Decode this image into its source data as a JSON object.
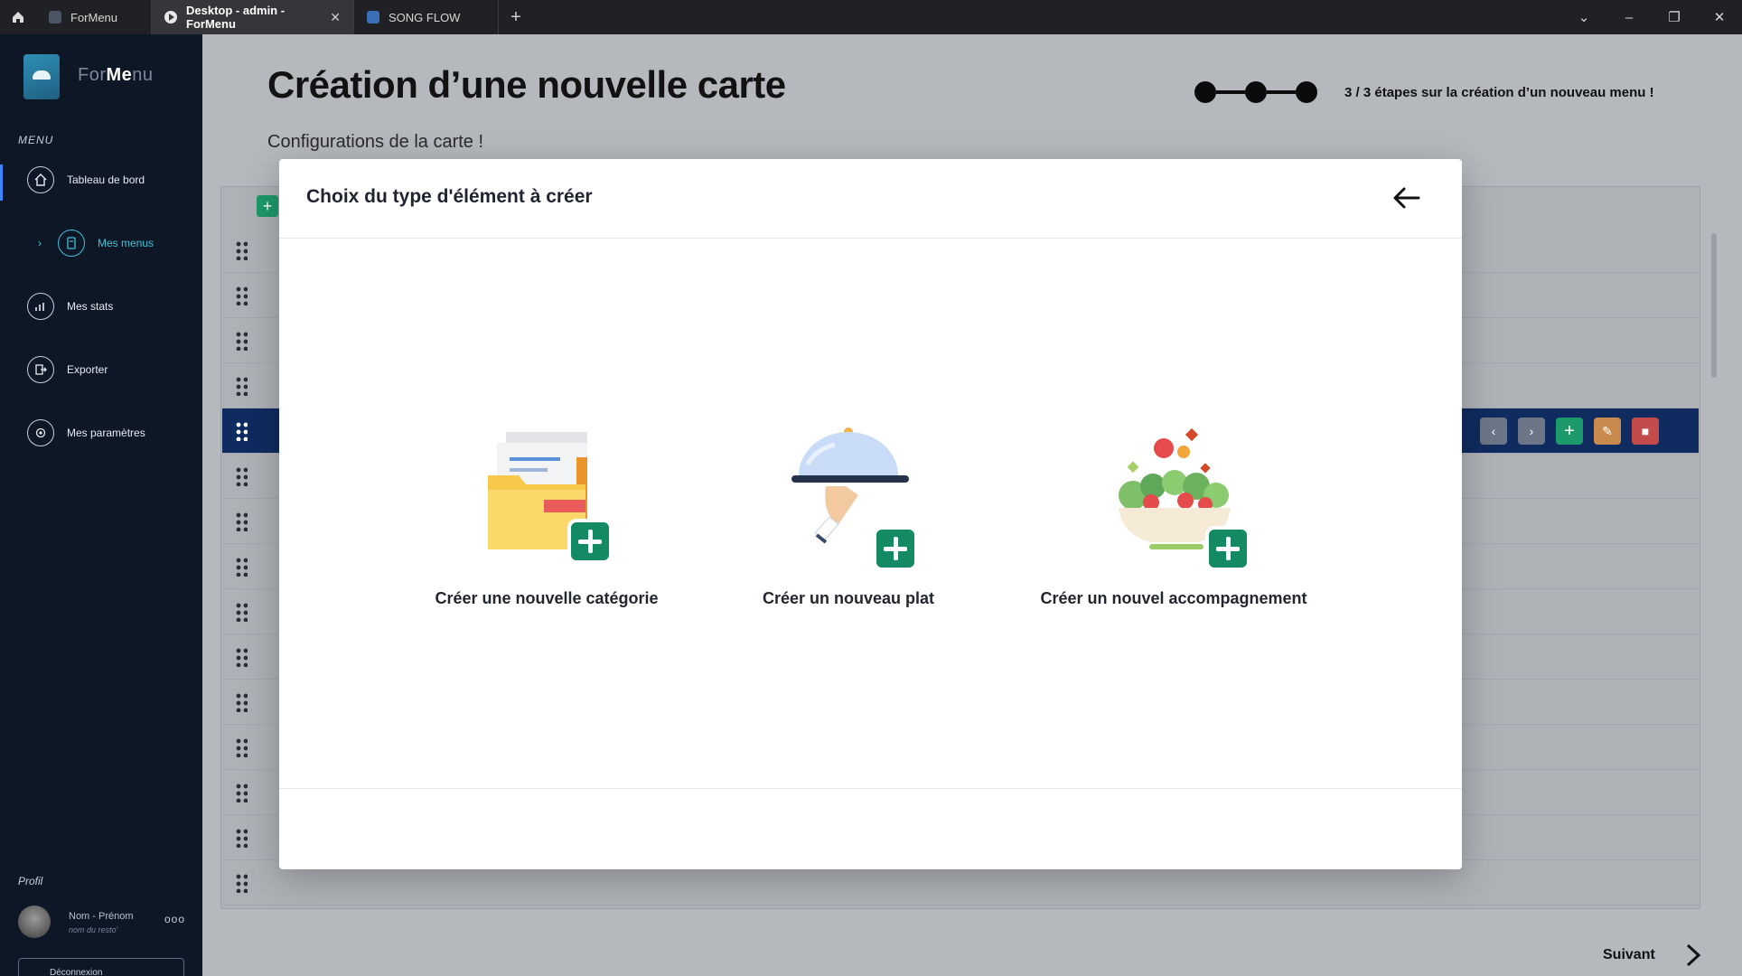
{
  "browser": {
    "tabs": [
      {
        "label": "ForMenu",
        "active": false
      },
      {
        "label": "Desktop - admin - ForMenu",
        "active": true
      },
      {
        "label": "SONG FLOW",
        "active": false
      }
    ],
    "new_tab": "+",
    "close": "✕"
  },
  "sidebar": {
    "brand_light": "For",
    "brand_bold": "Me",
    "brand_tail": "nu",
    "menu_label": "MENU",
    "items": [
      {
        "label": "Tableau de bord",
        "icon": "home-icon"
      },
      {
        "label": "Mes menus",
        "icon": "menu-book-icon"
      },
      {
        "label": "Mes stats",
        "icon": "stats-icon"
      },
      {
        "label": "Exporter",
        "icon": "export-icon"
      },
      {
        "label": "Mes paramètres",
        "icon": "settings-icon"
      }
    ],
    "profile_label": "Profil",
    "profile_name": "Nom - Prénom",
    "profile_resto": "nom du resto'",
    "profile_more": "ooo",
    "logout": "Déconnexion"
  },
  "main": {
    "title": "Création d’une nouvelle carte",
    "subtitle": "Configurations de la carte !",
    "step_text": "3 / 3 étapes sur la création d’un nouveau menu !",
    "step_progress": "3/3",
    "next_label": "Suivant"
  },
  "modal": {
    "title": "Choix du type d'élément à créer",
    "choices": [
      {
        "label": "Créer une nouvelle catégorie",
        "icon": "folder-plus-icon"
      },
      {
        "label": "Créer un nouveau plat",
        "icon": "cloche-plus-icon"
      },
      {
        "label": "Créer un nouvel accompagnement",
        "icon": "salad-plus-icon"
      }
    ]
  },
  "colors": {
    "sidebar_bg": "#0d1726",
    "accent_cyan": "#3ec3d9",
    "add_green": "#138a63",
    "row_highlight": "#0f2b5f",
    "edit_orange": "#c98a4d",
    "delete_red": "#c44b4b"
  }
}
